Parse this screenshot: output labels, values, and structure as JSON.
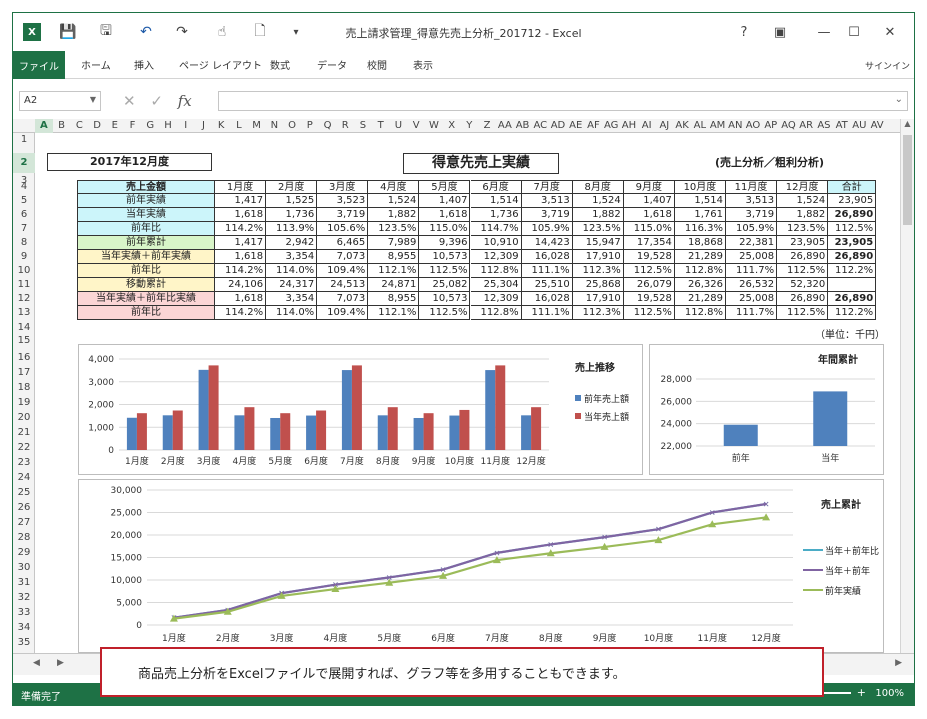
{
  "window": {
    "title": "売上請求管理_得意先売上分析_201712 - Excel"
  },
  "titlebar": {
    "help": "?",
    "restore_ribbon": "▣",
    "minimize": "—",
    "maximize": "☐",
    "close": "✕"
  },
  "ribbon": {
    "tabs": [
      "ファイル",
      "ホーム",
      "挿入",
      "ページ レイアウト",
      "数式",
      "データ",
      "校閲",
      "表示"
    ],
    "signin": "サインイン"
  },
  "formula_bar": {
    "name_box": "A2",
    "fx": "fx",
    "value": ""
  },
  "columns": [
    "A",
    "B",
    "C",
    "D",
    "E",
    "F",
    "G",
    "H",
    "I",
    "J",
    "K",
    "L",
    "M",
    "N",
    "O",
    "P",
    "Q",
    "R",
    "S",
    "T",
    "U",
    "V",
    "W",
    "X",
    "Y",
    "Z",
    "AA",
    "AB",
    "AC",
    "AD",
    "AE",
    "AF",
    "AG",
    "AH",
    "AI",
    "AJ",
    "AK",
    "AL",
    "AM",
    "AN",
    "AO",
    "AP",
    "AQ",
    "AR",
    "AS",
    "AT",
    "AU",
    "AV"
  ],
  "rows": [
    "1",
    "2",
    "3",
    "4",
    "5",
    "6",
    "7",
    "8",
    "9",
    "10",
    "11",
    "12",
    "13",
    "14",
    "15",
    "16",
    "17",
    "18",
    "19",
    "20",
    "21",
    "22",
    "23",
    "24",
    "25",
    "26",
    "27",
    "28",
    "29",
    "30",
    "31",
    "32",
    "33",
    "34",
    "35",
    "36",
    "37"
  ],
  "sheet": {
    "date_label": "2017年12月度",
    "title": "得意先売上実績",
    "subtitle": "(売上分析／粗利分析)",
    "unit": "（単位：千円）",
    "header_label": "売上金額",
    "months": [
      "1月度",
      "2月度",
      "3月度",
      "4月度",
      "5月度",
      "6月度",
      "7月度",
      "8月度",
      "9月度",
      "10月度",
      "11月度",
      "12月度"
    ],
    "total_label": "合計",
    "table": [
      {
        "label": "前年実績",
        "color": "#ccf5fa",
        "values": [
          "1,417",
          "1,525",
          "3,523",
          "1,524",
          "1,407",
          "1,514",
          "3,513",
          "1,524",
          "1,407",
          "1,514",
          "3,513",
          "1,524"
        ],
        "total": "23,905",
        "total_bold": false
      },
      {
        "label": "当年実績",
        "color": "#ccf5fa",
        "values": [
          "1,618",
          "1,736",
          "3,719",
          "1,882",
          "1,618",
          "1,736",
          "3,719",
          "1,882",
          "1,618",
          "1,761",
          "3,719",
          "1,882"
        ],
        "total": "26,890",
        "total_bold": true
      },
      {
        "label": "前年比",
        "color": "#ccf5fa",
        "values": [
          "114.2%",
          "113.9%",
          "105.6%",
          "123.5%",
          "115.0%",
          "114.7%",
          "105.9%",
          "123.5%",
          "115.0%",
          "116.3%",
          "105.9%",
          "123.5%"
        ],
        "total": "112.5%",
        "total_bold": false
      },
      {
        "label": "前年累計",
        "color": "#d8f5c8",
        "values": [
          "1,417",
          "2,942",
          "6,465",
          "7,989",
          "9,396",
          "10,910",
          "14,423",
          "15,947",
          "17,354",
          "18,868",
          "22,381",
          "23,905"
        ],
        "total": "23,905",
        "total_bold": true
      },
      {
        "label": "当年実績＋前年実績",
        "color": "#fff5c8",
        "values": [
          "1,618",
          "3,354",
          "7,073",
          "8,955",
          "10,573",
          "12,309",
          "16,028",
          "17,910",
          "19,528",
          "21,289",
          "25,008",
          "26,890"
        ],
        "total": "26,890",
        "total_bold": true
      },
      {
        "label": "前年比",
        "color": "#fff5c8",
        "values": [
          "114.2%",
          "114.0%",
          "109.4%",
          "112.1%",
          "112.5%",
          "112.8%",
          "111.1%",
          "112.3%",
          "112.5%",
          "112.8%",
          "111.7%",
          "112.5%"
        ],
        "total": "112.2%",
        "total_bold": false
      },
      {
        "label": "移動累計",
        "color": "#fff5c8",
        "values": [
          "24,106",
          "24,317",
          "24,513",
          "24,871",
          "25,082",
          "25,304",
          "25,510",
          "25,868",
          "26,079",
          "26,326",
          "26,532",
          "52,320"
        ],
        "total": "",
        "total_bold": false
      },
      {
        "label": "当年実績＋前年比実績",
        "color": "#fbd5d5",
        "values": [
          "1,618",
          "3,354",
          "7,073",
          "8,955",
          "10,573",
          "12,309",
          "16,028",
          "17,910",
          "19,528",
          "21,289",
          "25,008",
          "26,890"
        ],
        "total": "26,890",
        "total_bold": true
      },
      {
        "label": "前年比",
        "color": "#fbd5d5",
        "values": [
          "114.2%",
          "114.0%",
          "109.4%",
          "112.1%",
          "112.5%",
          "112.8%",
          "111.1%",
          "112.3%",
          "112.5%",
          "112.8%",
          "111.7%",
          "112.5%"
        ],
        "total": "112.2%",
        "total_bold": false
      }
    ],
    "row37_total": "合計"
  },
  "chart_data": [
    {
      "type": "bar",
      "title": "売上推移",
      "categories": [
        "1月度",
        "2月度",
        "3月度",
        "4月度",
        "5月度",
        "6月度",
        "7月度",
        "8月度",
        "9月度",
        "10月度",
        "11月度",
        "12月度"
      ],
      "series": [
        {
          "name": "前年売上額",
          "color": "#4f81bd",
          "values": [
            1417,
            1525,
            3523,
            1524,
            1407,
            1514,
            3513,
            1524,
            1407,
            1514,
            3513,
            1524
          ]
        },
        {
          "name": "当年売上額",
          "color": "#c0504d",
          "values": [
            1618,
            1736,
            3719,
            1882,
            1618,
            1736,
            3719,
            1882,
            1618,
            1761,
            3719,
            1882
          ]
        }
      ],
      "ylim": [
        0,
        4000
      ],
      "yticks": [
        "0",
        "1,000",
        "2,000",
        "3,000",
        "4,000"
      ],
      "legend": "right"
    },
    {
      "type": "bar",
      "title": "年間累計",
      "categories": [
        "前年",
        "当年"
      ],
      "values": [
        23905,
        26890
      ],
      "color": "#4f81bd",
      "ylim": [
        22000,
        28000
      ],
      "yticks": [
        "22,000",
        "24,000",
        "26,000",
        "28,000"
      ]
    },
    {
      "type": "line",
      "title": "売上累計",
      "categories": [
        "1月度",
        "2月度",
        "3月度",
        "4月度",
        "5月度",
        "6月度",
        "7月度",
        "8月度",
        "9月度",
        "10月度",
        "11月度",
        "12月度"
      ],
      "series": [
        {
          "name": "当年＋前年比",
          "color": "#4bacc6",
          "values": [
            1618,
            3354,
            7073,
            8955,
            10573,
            12309,
            16028,
            17910,
            19528,
            21289,
            25008,
            26890
          ]
        },
        {
          "name": "当年＋前年",
          "color": "#8064a2",
          "values": [
            1618,
            3354,
            7073,
            8955,
            10573,
            12309,
            16028,
            17910,
            19528,
            21289,
            25008,
            26890
          ]
        },
        {
          "name": "前年実績",
          "color": "#9bbb59",
          "values": [
            1417,
            2942,
            6465,
            7989,
            9396,
            10910,
            14423,
            15947,
            17354,
            18868,
            22381,
            23905
          ]
        }
      ],
      "ylim": [
        0,
        30000
      ],
      "yticks": [
        "0",
        "5,000",
        "10,000",
        "15,000",
        "20,000",
        "25,000",
        "30,000"
      ],
      "legend": "right"
    }
  ],
  "status": {
    "ready": "準備完了",
    "zoom": "100%",
    "zoom_minus": "—",
    "zoom_plus": "+"
  },
  "callout": "商品売上分析をExcelファイルで展開すれば、グラフ等を多用することもできます。"
}
